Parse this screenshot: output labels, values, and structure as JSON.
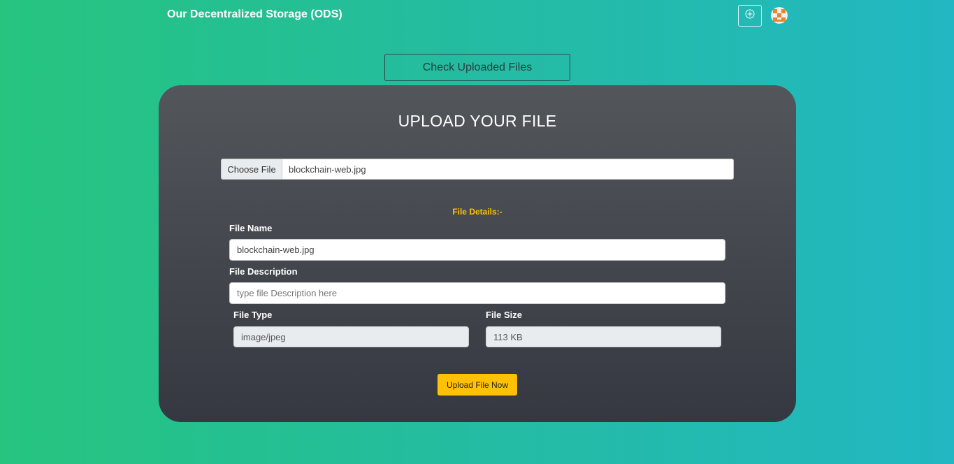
{
  "header": {
    "brand": "Our Decentralized Storage (ODS)",
    "add_icon": "plus-circle-icon",
    "avatar_icon": "user-avatar-icon"
  },
  "check_files_label": "Check Uploaded Files",
  "card": {
    "title": "UPLOAD YOUR FILE",
    "file_picker": {
      "button_label": "Choose File",
      "chosen_file": "blockchain-web.jpg"
    },
    "details_heading": "File Details:-",
    "fields": {
      "file_name": {
        "label": "File Name",
        "value": "blockchain-web.jpg"
      },
      "file_description": {
        "label": "File Description",
        "value": "",
        "placeholder": "type file Description here"
      },
      "file_type": {
        "label": "File Type",
        "value": "image/jpeg"
      },
      "file_size": {
        "label": "File Size",
        "value": "113 KB"
      }
    },
    "upload_label": "Upload File Now"
  },
  "colors": {
    "gradient_left": "#26c47f",
    "gradient_right": "#22b7c2",
    "card_top": "#53565b",
    "card_bottom": "#353840",
    "accent": "#ffc107"
  }
}
